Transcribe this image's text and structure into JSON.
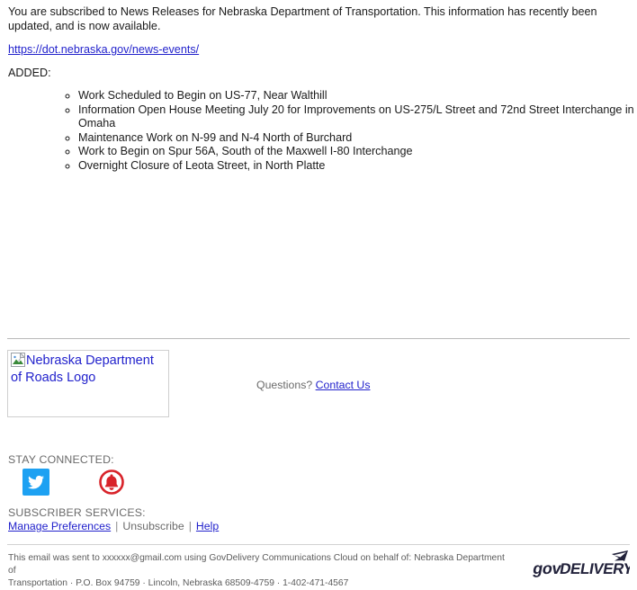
{
  "email": {
    "intro_line1": "You are subscribed to News Releases for Nebraska Department of Transportation. This information has recently been updated, and",
    "intro_line2": "is now available.",
    "intro_full": "You are subscribed to News Releases for Nebraska Department of Transportation. This information has recently been updated, and is now available.",
    "link_url_text": "https://dot.nebraska.gov/news-events/",
    "added_label": "ADDED:",
    "releases": [
      "Work Scheduled to Begin on US-77, Near Walthill",
      "Information Open House Meeting July 20 for Improvements on US-275/L Street and 72nd Street Interchange in Omaha",
      "Maintenance Work on N-99 and N-4 North of Burchard",
      "Work to Begin on Spur 56A, South of the Maxwell I-80 Interchange",
      "Overnight Closure of Leota Street, in North Platte"
    ]
  },
  "logo_block": {
    "alt_text": "Nebraska Department of Roads Logo",
    "icon": "broken-image-icon"
  },
  "questions": {
    "label": "Questions?",
    "link_label": "Contact Us"
  },
  "stay_connected": {
    "label": "STAY CONNECTED:",
    "icons": [
      {
        "name": "twitter-icon",
        "label": "Twitter",
        "color": "#1DA1F2"
      },
      {
        "name": "govdelivery-bell-icon",
        "label": "GovDelivery Notifications",
        "color": "#D8232A"
      }
    ]
  },
  "subscriber_services": {
    "label": "SUBSCRIBER SERVICES:",
    "manage_preferences": "Manage Preferences",
    "unsubscribe": "Unsubscribe",
    "help": "Help",
    "separator": "|"
  },
  "footer": {
    "line1": "This email was sent to xxxxxx@gmail.com using GovDelivery Communications Cloud on behalf of: Nebraska Department of",
    "line2": "Transportation · P.O. Box 94759 · Lincoln, Nebraska 68509-4759 · 1-402-471-4567",
    "brand": "govDELIVERY",
    "brand_gov": "gov",
    "brand_delivery": "DELIVERY"
  },
  "colors": {
    "link": "#2222cc",
    "muted_text": "#6b6b6b",
    "body_text": "#1a1a1a",
    "divider": "#b9b9b9",
    "twitter": "#1DA1F2",
    "bell_red": "#D8232A",
    "govdelivery_dark": "#22223b"
  }
}
